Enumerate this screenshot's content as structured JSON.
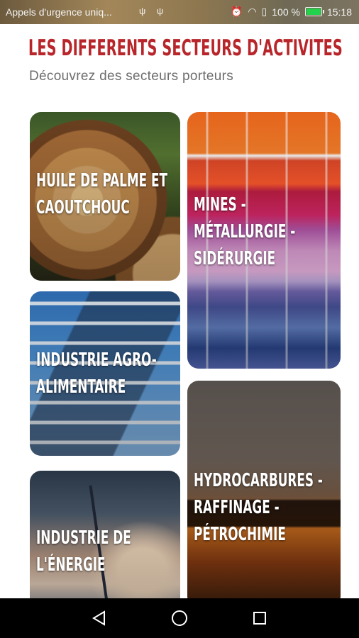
{
  "status_bar": {
    "carrier": "Appels d'urgence uniq...",
    "battery": "100 %",
    "time": "15:18",
    "icons": [
      "usb-icon",
      "usb-icon",
      "alarm-icon",
      "wifi-icon",
      "sim-icon",
      "battery-icon"
    ]
  },
  "header": {
    "title": "LES DIFFERENTS SECTEURS D'ACTIVITES",
    "subtitle": "Découvrez des secteurs porteurs"
  },
  "sectors": [
    {
      "label": "HUILE DE PALME ET\nCAOUTCHOUC",
      "image": "logs-photo"
    },
    {
      "label": "MINES -\nMÉTALLURGIE -\nSIDÉRURGIE",
      "image": "yarn-photo"
    },
    {
      "label": "INDUSTRIE AGRO-\nALIMENTAIRE",
      "image": "building-photo"
    },
    {
      "label": "HYDROCARBURES -\nRAFFINAGE -\nPÉTROCHIMIE",
      "image": "refinery-photo"
    },
    {
      "label": "INDUSTRIE DE\nL'ÉNERGIE",
      "image": "wind-turbine-photo"
    }
  ],
  "colors": {
    "title": "#b8252a",
    "subtitle": "#6d6d6d",
    "navbar": "#000000"
  },
  "nav": [
    "back-icon",
    "home-icon",
    "recents-icon"
  ]
}
